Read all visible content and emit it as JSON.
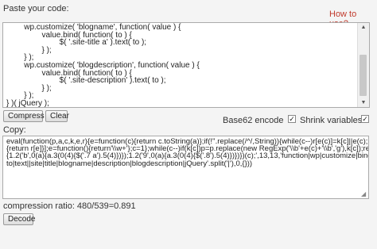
{
  "paste_label": "Paste your code:",
  "howto_link": "How to use?",
  "input_code_lines": [
    "        wp.customize( 'blogname', function( value ) {",
    "                value.bind( function( to ) {",
    "                        $( '.site-title a' ).text( to );",
    "                } );",
    "        } );",
    "        wp.customize( 'blogdescription', function( value ) {",
    "                value.bind( function( to ) {",
    "                        $( '.site-description' ).text( to );",
    "                } );",
    "        } );",
    "} )( jQuery );"
  ],
  "compress_button": "Compress",
  "clear_button": "Clear",
  "base62_label": "Base62 encode",
  "base62_checked": true,
  "shrink_label": "Shrink variables",
  "shrink_checked": true,
  "copy_label": "Copy:",
  "output_lines": [
    "eval(function(p,a,c,k,e,r){e=function(c){return c.toString(a)};if(!''.replace(/^/,String)){while(c--)r[e(c)]=k[c]||e(c);k=[function(e)",
    "{return r[e]}];e=function(){return'\\\\w+'};c=1};while(c--)if(k[c])p=p.replace(new RegExp('\\\\b'+e(c)+'\\\\b','g'),k[c]);return p}('(0($)",
    "{1.2('b',0(a){a.3(0(4){$('.7 a').5(4)})});1.2('9',0(a){a.3(0(4){$('.8').5(4)})})})(c);',13,13,'function|wp|customize|bind|",
    "to|text||site|title|blogname|description|blogdescription|jQuery'.split('|'),0,{}))"
  ],
  "ratio_label": "compression ratio: 480/539=0.891",
  "decode_button": "Decode"
}
